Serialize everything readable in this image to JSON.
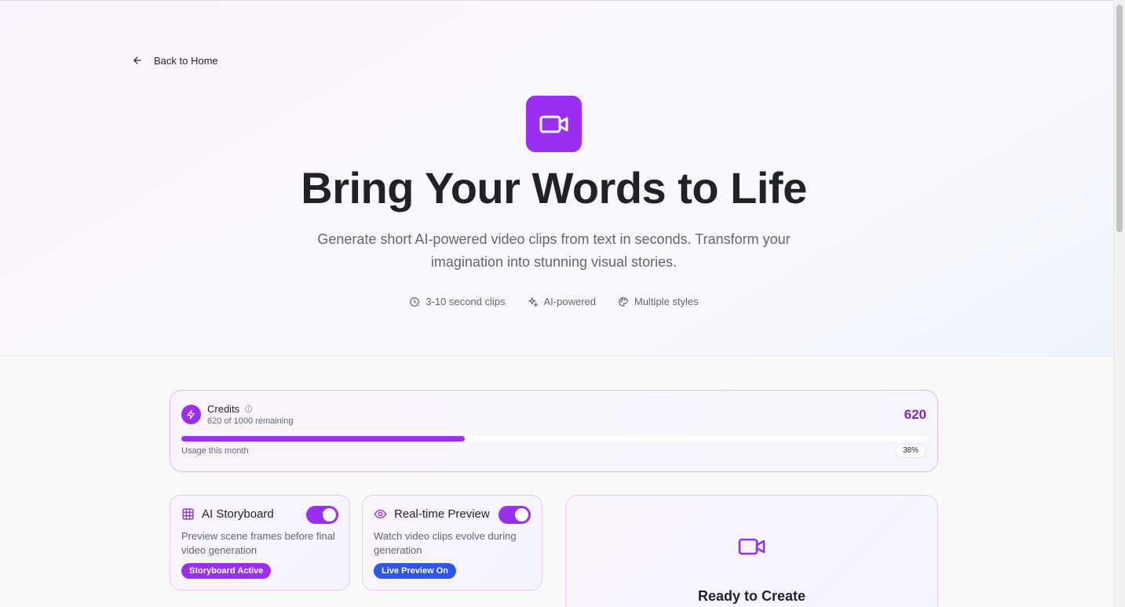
{
  "nav": {
    "back_label": "Back to Home"
  },
  "hero": {
    "title": "Bring Your Words to Life",
    "subtitle_line1": "Generate short AI-powered video clips from text in seconds. Transform your",
    "subtitle_line2": "imagination into stunning visual stories.",
    "features": [
      {
        "icon": "clock-icon",
        "label": "3-10 second clips"
      },
      {
        "icon": "sparkles-icon",
        "label": "AI-powered"
      },
      {
        "icon": "palette-icon",
        "label": "Multiple styles"
      }
    ]
  },
  "credits": {
    "title": "Credits",
    "remaining_text": "620 of 1000 remaining",
    "value": "620",
    "usage_label": "Usage this month",
    "usage_percent_label": "38%",
    "usage_fraction": 0.38
  },
  "cards": {
    "storyboard": {
      "title": "AI Storyboard",
      "description": "Preview scene frames before final video generation",
      "badge": "Storyboard Active",
      "enabled": true
    },
    "preview": {
      "title": "Real-time Preview",
      "description": "Watch video clips evolve during generation",
      "badge": "Live Preview On",
      "enabled": true
    }
  },
  "create_panel": {
    "title": "Ready to Create"
  },
  "colors": {
    "accent": "#9a2ff2",
    "accent_dark": "#8a1fc9",
    "badge_blue": "#2f56e6",
    "text": "#1f2329",
    "muted": "#5f6775"
  }
}
